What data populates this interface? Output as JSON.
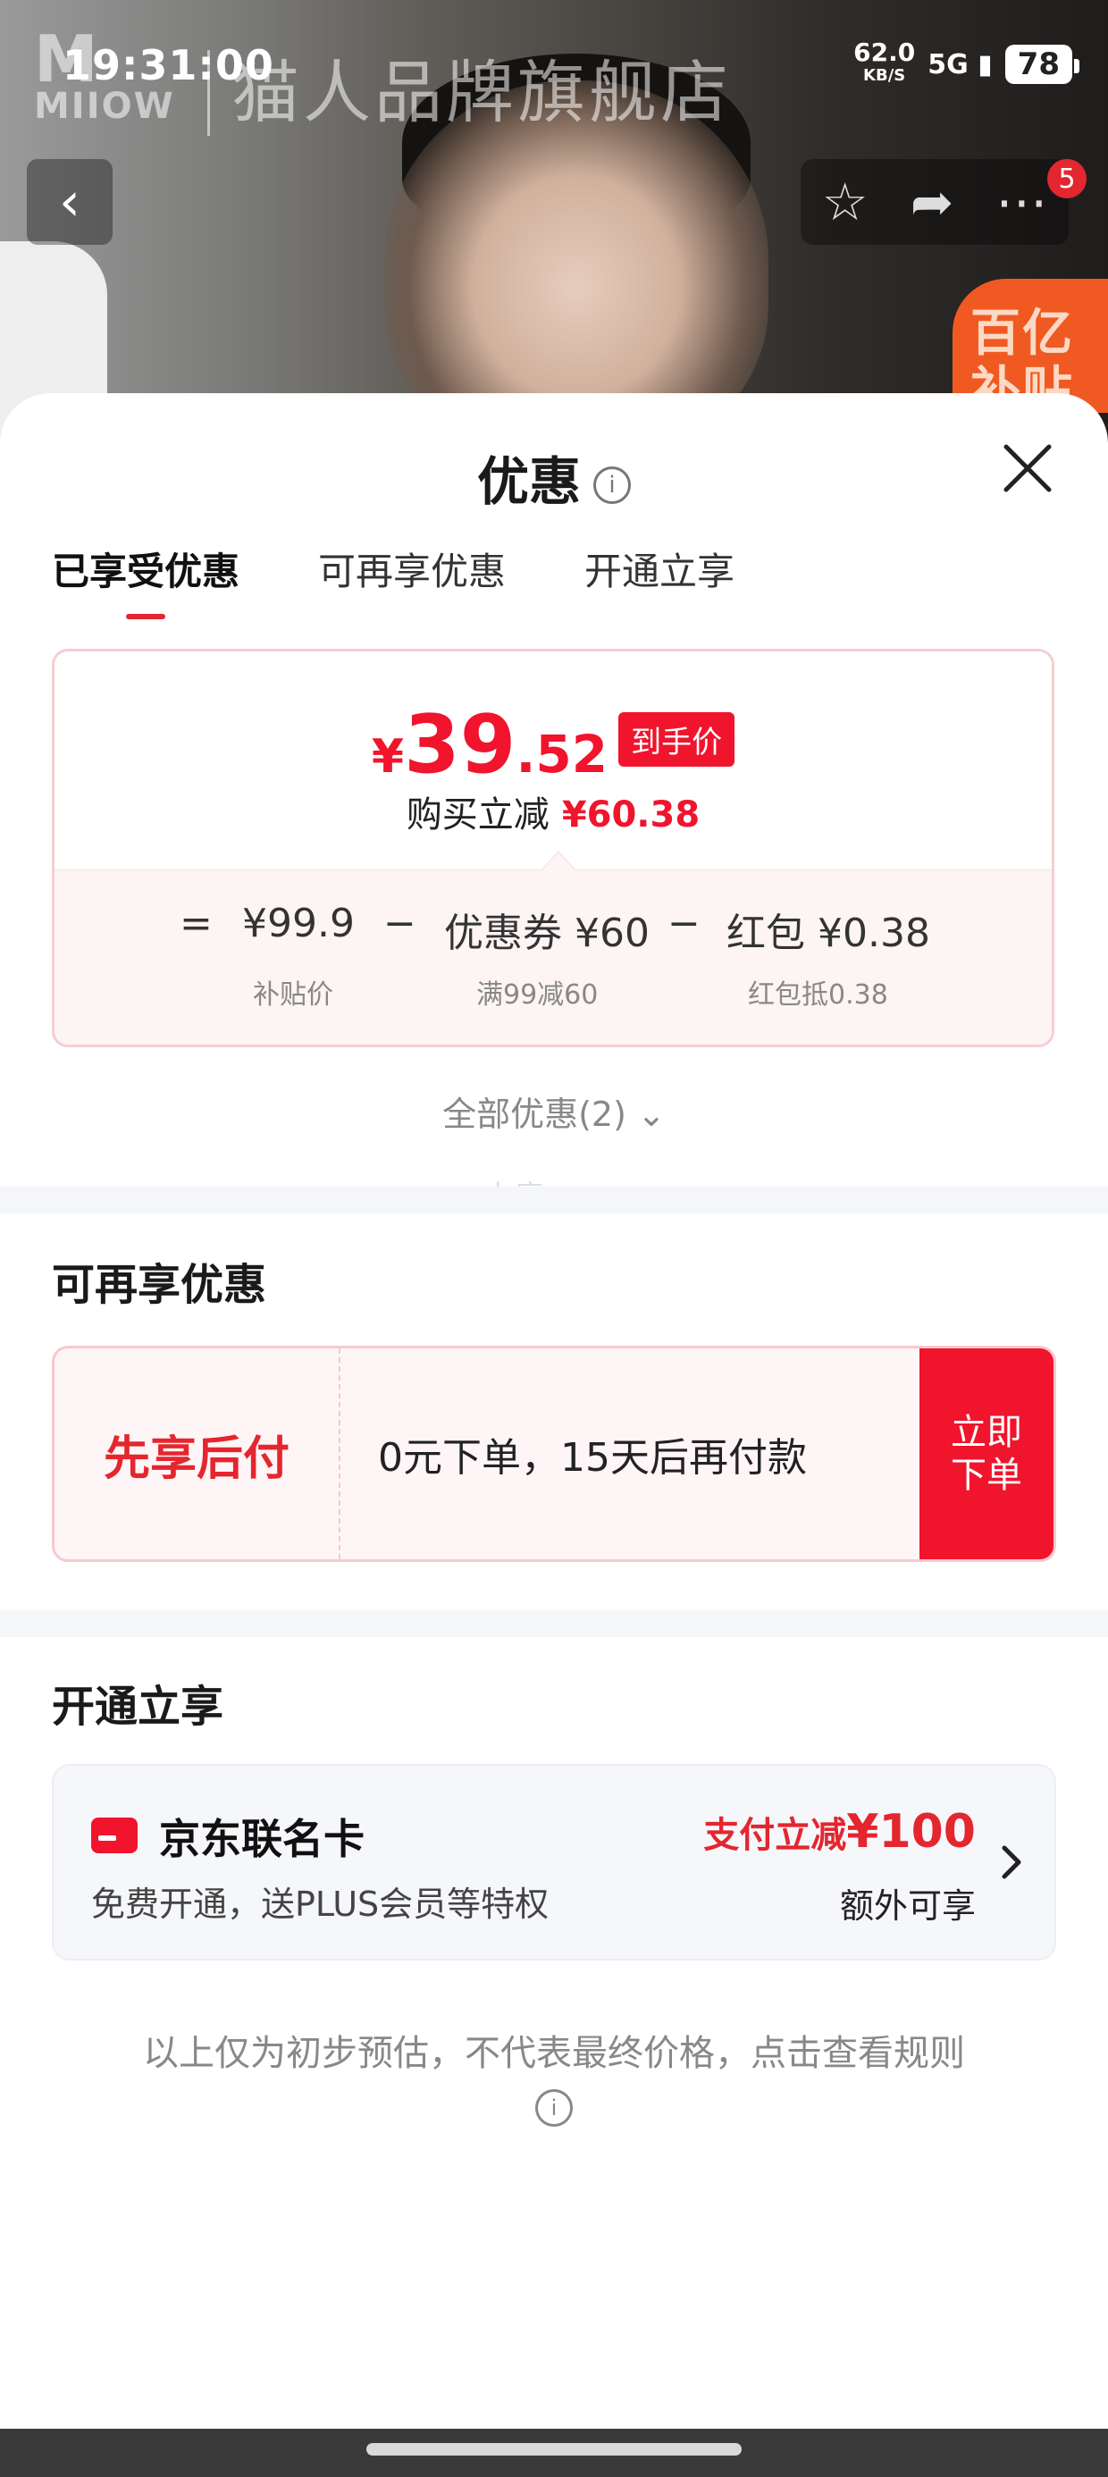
{
  "status_bar": {
    "time": "19:31:00",
    "net_speed": "62.0",
    "net_unit": "KB/S",
    "signal": "5G",
    "battery": "78"
  },
  "header": {
    "brand_logo": "MIIOW",
    "store_name": "猫人品牌旗舰店",
    "cart_badge": "5",
    "subsidy_tag": "百亿补贴"
  },
  "sheet": {
    "title": "优惠",
    "tabs": [
      "已享受优惠",
      "可再享优惠",
      "开通立享"
    ],
    "price": {
      "currency": "¥",
      "integer": "39",
      "decimal": ".52",
      "tag": "到手价",
      "save_label": "购买立减",
      "save_amount": "¥60.38"
    },
    "breakdown": {
      "eq": "=",
      "minus": "−",
      "items": [
        {
          "value": "¥99.9",
          "sub": "补贴价"
        },
        {
          "value": "优惠券 ¥60",
          "sub": "满99减60"
        },
        {
          "value": "红包 ¥0.38",
          "sub": "红包抵0.38"
        }
      ]
    },
    "all_offers": "全部优惠(2)",
    "watermark": "小瘾",
    "more_offers": {
      "title": "可再享优惠",
      "bnpl_label": "先享后付",
      "bnpl_desc": "0元下单，15天后再付款",
      "bnpl_button": "立即下单"
    },
    "open_enjoy": {
      "title": "开通立享",
      "card_name": "京东联名卡",
      "card_desc": "免费开通，送PLUS会员等特权",
      "promo_prefix": "支付立减",
      "promo_amount": "¥100",
      "extra": "额外可享"
    },
    "disclaimer": "以上仅为初步预估，不代表最终价格，点击查看规则"
  }
}
